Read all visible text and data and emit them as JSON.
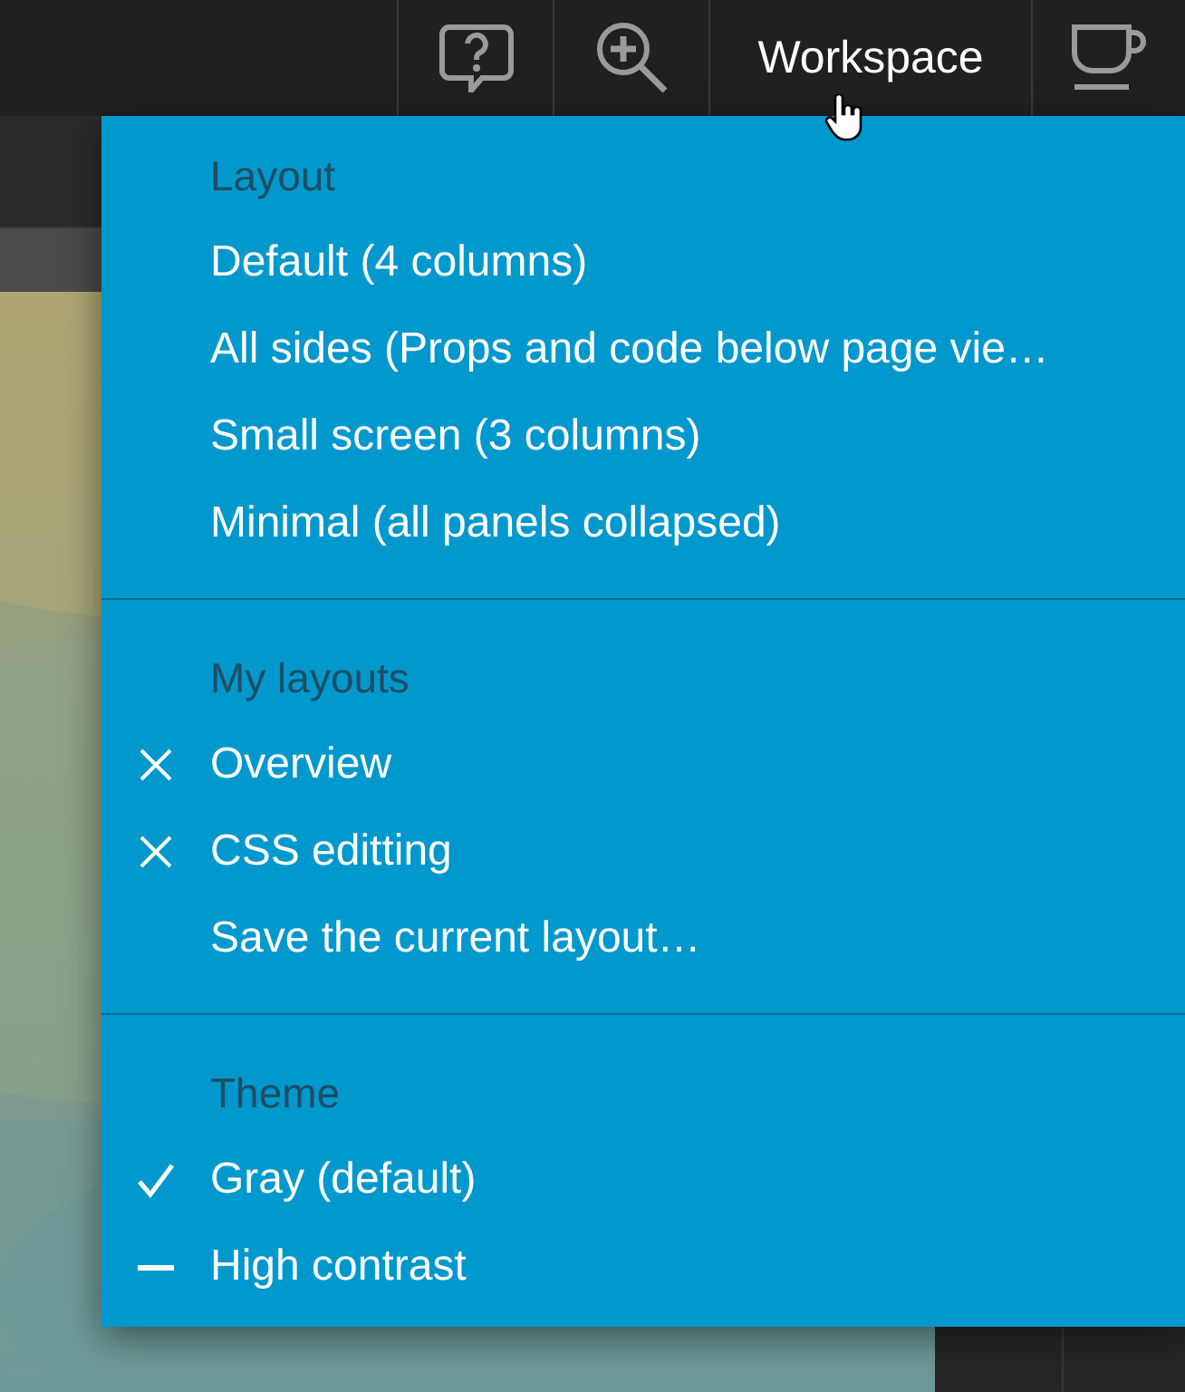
{
  "toolbar": {
    "workspace_label": "Workspace"
  },
  "menu": {
    "sections": [
      {
        "header": "Layout",
        "items": [
          {
            "label": "Default (4 columns)",
            "kind": "plain"
          },
          {
            "label": "All sides (Props and code below page vie…",
            "kind": "plain"
          },
          {
            "label": "Small screen (3 columns)",
            "kind": "plain"
          },
          {
            "label": "Minimal (all panels collapsed)",
            "kind": "plain"
          }
        ]
      },
      {
        "header": "My layouts",
        "items": [
          {
            "label": "Overview",
            "kind": "removable"
          },
          {
            "label": "CSS editting",
            "kind": "removable"
          },
          {
            "label": "Save the current layout…",
            "kind": "plain"
          }
        ]
      },
      {
        "header": "Theme",
        "items": [
          {
            "label": "Gray (default)",
            "kind": "checked"
          },
          {
            "label": "High contrast",
            "kind": "dashed"
          }
        ]
      }
    ]
  }
}
